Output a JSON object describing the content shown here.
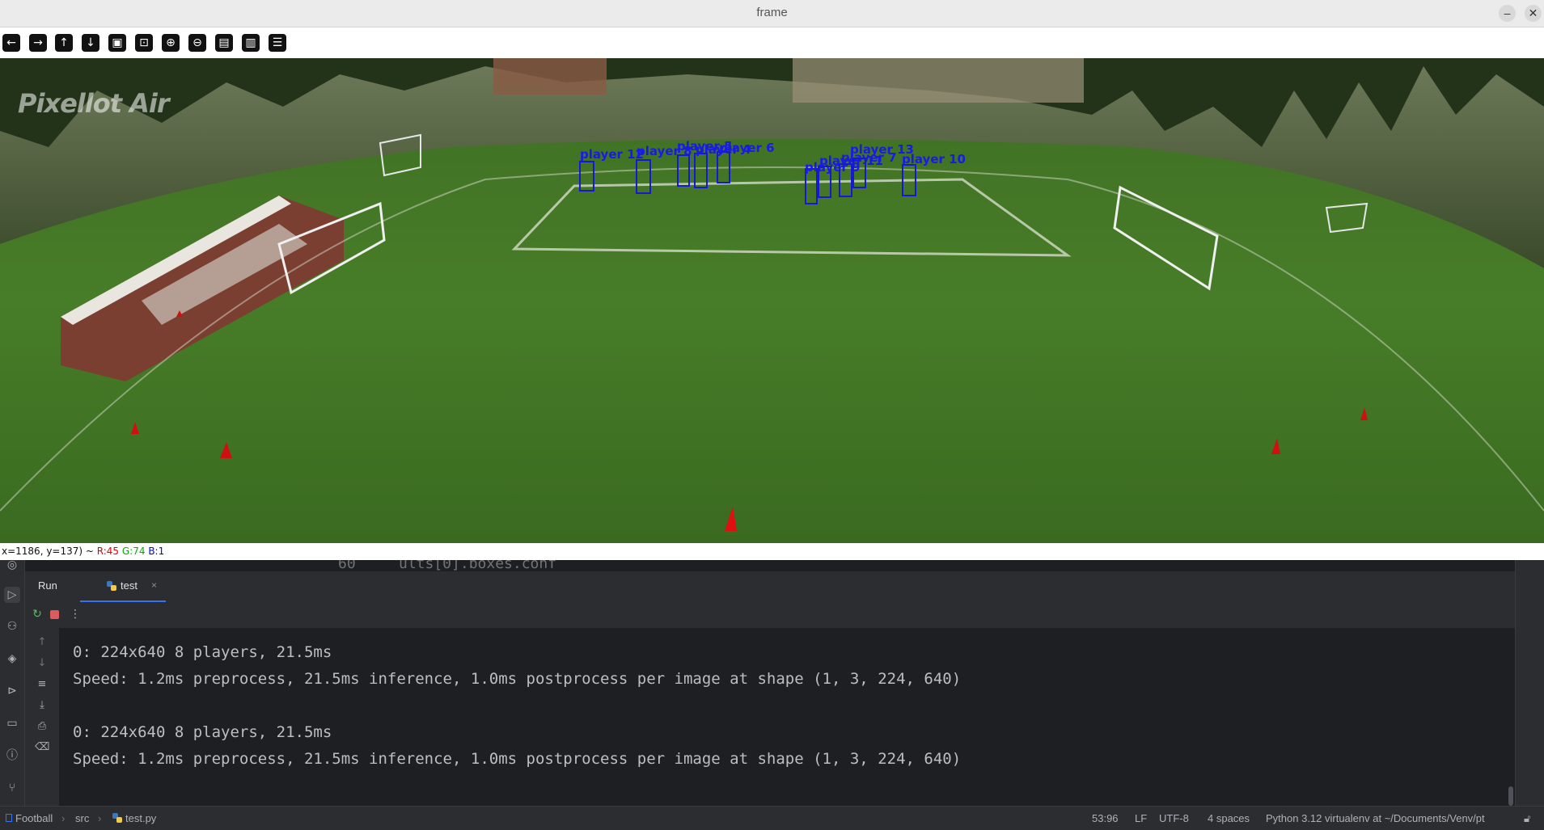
{
  "window": {
    "title": "frame",
    "minimize_glyph": "–",
    "close_glyph": "✕"
  },
  "toolbar": {
    "buttons": [
      {
        "name": "pan-left-icon",
        "glyph": "←"
      },
      {
        "name": "pan-right-icon",
        "glyph": "→"
      },
      {
        "name": "pan-up-icon",
        "glyph": "↑"
      },
      {
        "name": "pan-down-icon",
        "glyph": "↓"
      },
      {
        "name": "zoom-fit-icon",
        "glyph": "▣"
      },
      {
        "name": "zoom-original-icon",
        "glyph": "⊡"
      },
      {
        "name": "zoom-in-icon",
        "glyph": "⊕"
      },
      {
        "name": "zoom-out-icon",
        "glyph": "⊖"
      },
      {
        "name": "save-icon",
        "glyph": "▤"
      },
      {
        "name": "copy-clipboard-icon",
        "glyph": "▥"
      },
      {
        "name": "properties-icon",
        "glyph": "☰"
      }
    ]
  },
  "frame": {
    "watermark": "Pixellot Air",
    "players": [
      {
        "label": "player 12"
      },
      {
        "label": "player 8"
      },
      {
        "label": "player 5"
      },
      {
        "label": "player 4"
      },
      {
        "label": "player 6"
      },
      {
        "label": "player 9"
      },
      {
        "label": "player 11"
      },
      {
        "label": "player 7"
      },
      {
        "label": "player 13"
      },
      {
        "label": "player 10"
      }
    ]
  },
  "status": {
    "coords": "x=1186, y=137) ~",
    "r": "R:45",
    "g": "G:74",
    "b": "B:1"
  },
  "editor": {
    "line_number": "60",
    "code_fragment": "ults[0].boxes.conf"
  },
  "run_panel": {
    "run_label": "Run",
    "tab_name": "test",
    "tab_close": "×",
    "more_glyph": "⋮"
  },
  "console": {
    "lines": [
      "0: 224x640 8 players, 21.5ms",
      "Speed: 1.2ms preprocess, 21.5ms inference, 1.0ms postprocess per image at shape (1, 3, 224, 640)",
      "",
      "0: 224x640 8 players, 21.5ms",
      "Speed: 1.2ms preprocess, 21.5ms inference, 1.0ms postprocess per image at shape (1, 3, 224, 640)"
    ]
  },
  "ide_status": {
    "breadcrumb": [
      "Football",
      "src",
      "test.py"
    ],
    "separator": "›",
    "position": "53:96",
    "line_ending": "LF",
    "encoding": "UTF-8",
    "indent": "4 spaces",
    "interpreter": "Python 3.12 virtualenv at ~/Documents/Venv/pt"
  },
  "colors": {
    "box": "#1717d8",
    "accent": "#3574f0",
    "r": "#e00000",
    "g": "#00b000",
    "b": "#0000e0"
  }
}
